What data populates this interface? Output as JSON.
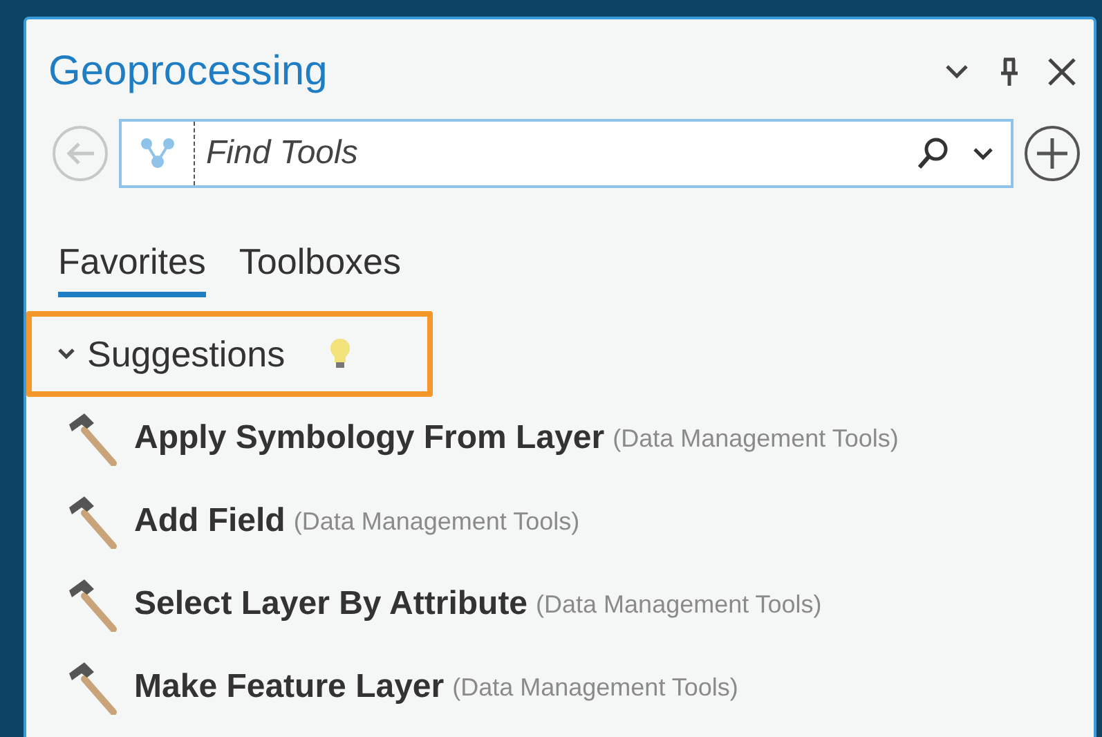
{
  "panel": {
    "title": "Geoprocessing"
  },
  "search": {
    "placeholder": "Find Tools",
    "back_disabled": true
  },
  "tabs": [
    {
      "label": "Favorites",
      "selected": true
    },
    {
      "label": "Toolboxes",
      "selected": false
    }
  ],
  "group": {
    "label": "Suggestions",
    "expanded": true,
    "highlighted": true,
    "items": [
      {
        "name": "Apply Symbology From Layer",
        "toolbox": "(Data Management Tools)"
      },
      {
        "name": "Add Field",
        "toolbox": "(Data Management Tools)"
      },
      {
        "name": "Select Layer By Attribute",
        "toolbox": "(Data Management Tools)"
      },
      {
        "name": "Make Feature Layer",
        "toolbox": "(Data Management Tools)"
      }
    ]
  }
}
